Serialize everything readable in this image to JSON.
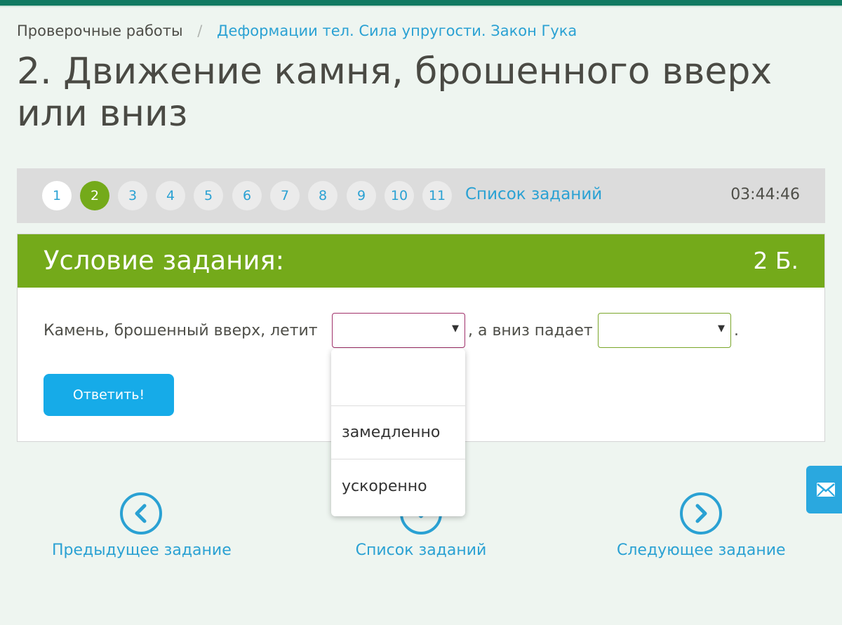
{
  "breadcrumb": {
    "root": "Проверочные работы",
    "separator": "/",
    "current": "Деформации тел. Сила упругости. Закон Гука"
  },
  "page_title": "2. Движение камня, брошенного вверх или вниз",
  "task_nav": {
    "tasks": [
      "1",
      "2",
      "3",
      "4",
      "5",
      "6",
      "7",
      "8",
      "9",
      "10",
      "11"
    ],
    "active_task": "2",
    "list_link": "Список заданий",
    "timer": "03:44:46"
  },
  "task_card": {
    "title": "Условие задания:",
    "points": "2 Б.",
    "question_part1": "Камень, брошенный  вверх, летит",
    "question_part2": ", а вниз падает",
    "question_end": ".",
    "select1_value": "",
    "select2_value": "",
    "answer_button": "Ответить!"
  },
  "dropdown": {
    "options": [
      "",
      "замедленно",
      "ускоренно"
    ]
  },
  "bottom_nav": {
    "prev": "Предыдущее задание",
    "list": "Список заданий",
    "next": "Следующее задание"
  },
  "icons": {
    "prev": "chevron-left-icon",
    "list": "grid-icon",
    "next": "chevron-right-icon",
    "mail": "mail-icon"
  },
  "colors": {
    "accent_blue": "#2aa1d3",
    "active_green": "#74aa1a",
    "button_blue": "#16abe8",
    "topbar": "#117a62"
  }
}
